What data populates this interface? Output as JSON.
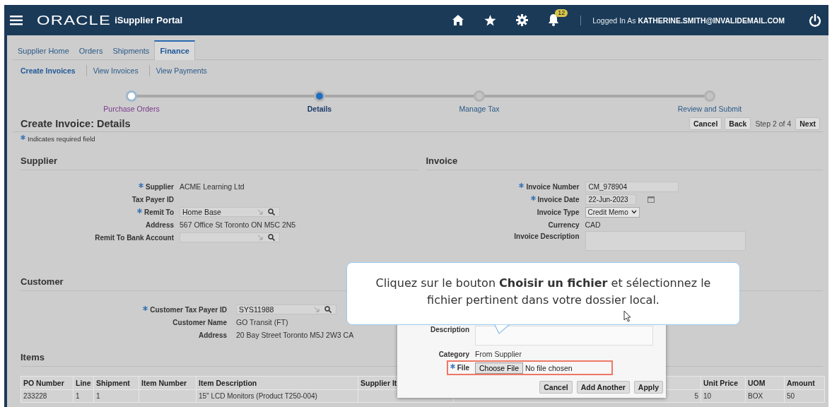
{
  "header": {
    "logo": "ORACLE",
    "app_name": "iSupplier Portal",
    "notification_count": "12",
    "user": "Logged In As **KATHERINE.SMITH@INVALIDEMAIL.COM**"
  },
  "tabs": [
    {
      "label": "Supplier Home",
      "selected": false
    },
    {
      "label": "Orders",
      "selected": false
    },
    {
      "label": "Shipments",
      "selected": false
    },
    {
      "label": "Finance",
      "selected": true
    }
  ],
  "subtabs": [
    {
      "label": "Create Invoices",
      "selected": true
    },
    {
      "label": "View Invoices",
      "selected": false
    },
    {
      "label": "View Payments",
      "selected": false
    }
  ],
  "train": [
    {
      "label": "Purchase Orders",
      "visited": true,
      "selected": false
    },
    {
      "label": "Details",
      "visited": false,
      "selected": true
    },
    {
      "label": "Manage Tax",
      "visited": false,
      "selected": false
    },
    {
      "label": "Review and Submit",
      "visited": false,
      "selected": false
    }
  ],
  "page_title": "Create Invoice: Details",
  "actions": [
    {
      "kind": "button",
      "label": "Cancel"
    },
    {
      "kind": "button",
      "label": "Back"
    },
    {
      "kind": "text",
      "label": "Step 2 of 4"
    },
    {
      "kind": "button",
      "label": "Next"
    }
  ],
  "required_note": "Indicates required field",
  "supplier": {
    "title": "Supplier",
    "fields": [
      {
        "label": "Supplier",
        "required": true,
        "kind": "text",
        "value": "ACME Learning Ltd"
      },
      {
        "label": "Tax Payer ID",
        "required": false,
        "kind": "text"
      },
      {
        "label": "Remit To",
        "required": true,
        "kind": "lov",
        "value": "Home Base"
      },
      {
        "label": "Address",
        "required": false,
        "kind": "text",
        "value": "567 Office St Toronto ON M5C 2N5"
      },
      {
        "label": "Remit To Bank Account",
        "required": false,
        "kind": "lov"
      }
    ]
  },
  "invoice": {
    "title": "Invoice",
    "fields": [
      {
        "label": "Invoice Number",
        "required": true,
        "kind": "input",
        "value": "CM_978904"
      },
      {
        "label": "Invoice Date",
        "required": true,
        "kind": "date",
        "value": "22-Jun-2023"
      },
      {
        "label": "Invoice Type",
        "required": false,
        "kind": "select",
        "value": "Credit Memo"
      },
      {
        "label": "Currency",
        "required": false,
        "kind": "text",
        "value": "CAD"
      },
      {
        "label": "Invoice Description",
        "required": false,
        "kind": "textarea"
      }
    ]
  },
  "customer": {
    "title": "Customer",
    "fields": [
      {
        "label": "Customer Tax Payer ID",
        "required": true,
        "kind": "lov",
        "value": "SYS11988"
      },
      {
        "label": "Customer Name",
        "required": false,
        "kind": "text",
        "value": "GO Transit (FT)"
      },
      {
        "label": "Address",
        "required": false,
        "kind": "text",
        "value": "20 Bay Street Toronto M5J 2W3 CA"
      }
    ]
  },
  "items": {
    "title": "Items",
    "columns": [
      "PO Number",
      "Line",
      "Shipment",
      "Item Number",
      "Item Description",
      "Supplier It",
      null,
      "Unit Price",
      "UOM",
      "Amount"
    ],
    "rows": [
      {
        "cells": [
          "233228",
          "1",
          "1",
          null,
          "15\" LCD Monitors (Product T250-004)",
          null,
          "5",
          "10",
          "BOX",
          "50"
        ]
      }
    ]
  },
  "dialog": {
    "fields": [
      {
        "label": "Description",
        "kind": "textarea",
        "required": false,
        "highlighted": false
      },
      {
        "label": "Category",
        "kind": "text",
        "value": "From Supplier",
        "required": false,
        "highlighted": false
      },
      {
        "label": "File",
        "kind": "file",
        "required": true,
        "highlighted": true,
        "button": "Choose File",
        "value": "No file chosen"
      }
    ],
    "buttons": [
      "Cancel",
      "Add Another",
      "Apply"
    ]
  },
  "callout": {
    "text": "Cliquez sur le bouton **Choisir un fichier** et sélectionnez le fichier pertinent dans votre dossier local."
  }
}
